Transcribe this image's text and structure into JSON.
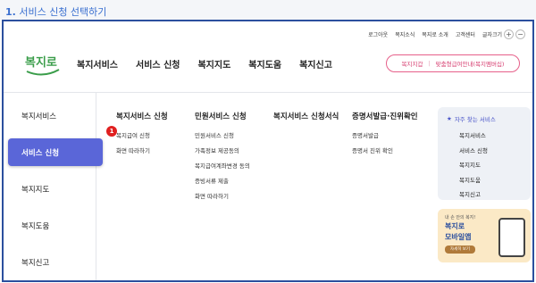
{
  "step": {
    "number": "1.",
    "title": "서비스 신청 선택하기"
  },
  "utility": {
    "links": [
      "로그아웃",
      "복지소식",
      "복지로 소개",
      "고객센터"
    ],
    "font_size_label": "글자크기",
    "plus": "+",
    "minus": "−"
  },
  "logo": {
    "text": "복지로"
  },
  "gnb": {
    "items": [
      "복지서비스",
      "서비스 신청",
      "복지지도",
      "복지도움",
      "복지신고"
    ]
  },
  "pill": {
    "left": "복지지갑",
    "sep": "|",
    "right": "맞춤형급여안내(복지멤버십)"
  },
  "sidebar": {
    "items": [
      "복지서비스",
      "서비스 신청",
      "복지지도",
      "복지도움",
      "복지신고"
    ],
    "active_index": 1
  },
  "columns": [
    {
      "head": "복지서비스 신청",
      "links": [
        "복지급여 신청",
        "화면 따라하기"
      ]
    },
    {
      "head": "민원서비스 신청",
      "links": [
        "민원서비스 신청",
        "가족정보 제공동의",
        "복지급여계좌변경 동의",
        "증빙서류 제출",
        "화면 따라하기"
      ]
    },
    {
      "head": "복지서비스 신청서식",
      "links": []
    },
    {
      "head": "증명서발급·진위확인",
      "links": [
        "증명서발급",
        "증명서 진위 확인"
      ]
    }
  ],
  "badge": "1",
  "quick": {
    "title": "자주 찾는 서비스",
    "items": [
      "복지서비스",
      "서비스 신청",
      "복지지도",
      "복지도움",
      "복지신고"
    ]
  },
  "app_banner": {
    "small": "내 손 안의 복지!",
    "title_line1": "복지로",
    "title_line2": "모바일앱",
    "button": "자세히 보기"
  },
  "colors": {
    "accent": "#5a66d8",
    "frame": "#2b4f9e",
    "pink": "#e6608a",
    "badge": "#e02020"
  }
}
